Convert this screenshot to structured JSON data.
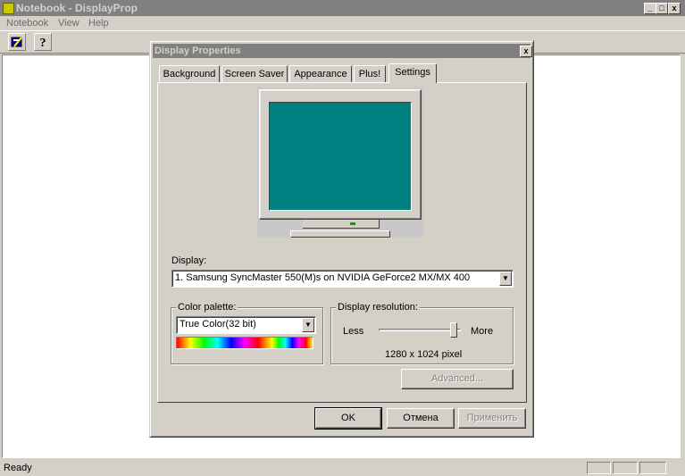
{
  "window": {
    "title": "Notebook - DisplayProp",
    "controls": {
      "minimize": "_",
      "maximize": "□",
      "close": "x"
    }
  },
  "menubar": {
    "items": [
      "Notebook",
      "View",
      "Help"
    ]
  },
  "toolbar": {
    "icons": [
      "properties-icon",
      "help-icon"
    ],
    "help_glyph": "?"
  },
  "statusbar": {
    "text": "Ready"
  },
  "dialog": {
    "title": "Display Properties",
    "close_glyph": "x",
    "tabs": [
      "Background",
      "Screen Saver",
      "Appearance",
      "Plus!",
      "Settings"
    ],
    "selected_tab": "Settings",
    "display_label": "Display:",
    "display_value": "1. Samsung SyncMaster 550(M)s on NVIDIA GeForce2 MX/MX 400",
    "color_palette": {
      "label": "Color palette:",
      "value": "True Color(32 bit)"
    },
    "resolution": {
      "label": "Display resolution:",
      "less": "Less",
      "more": "More",
      "value": "1280 x 1024 pixel",
      "level": 0.95
    },
    "advanced_label": "Advanced...",
    "ok_label": "OK",
    "cancel_label": "Отмена",
    "apply_label": "Применить",
    "monitor_screen_color": "#008080"
  }
}
